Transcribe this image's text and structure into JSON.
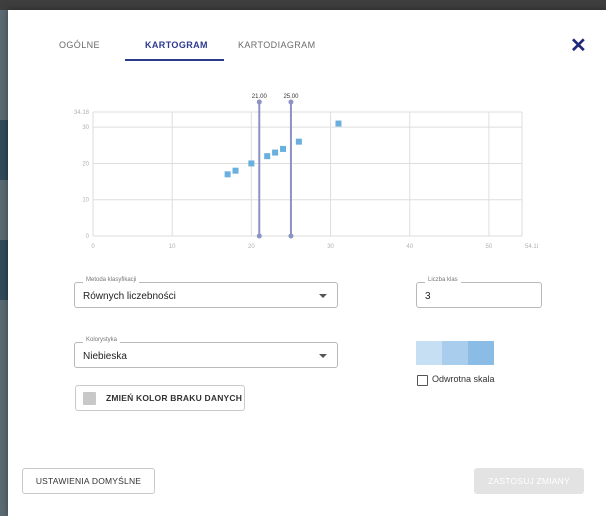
{
  "tabs": [
    {
      "label": "OGÓLNE",
      "active": false
    },
    {
      "label": "KARTOGRAM",
      "active": true
    },
    {
      "label": "KARTODIAGRAM",
      "active": false
    }
  ],
  "close_icon": "close-icon",
  "chart_data": {
    "type": "scatter",
    "xlim": [
      0,
      54.18
    ],
    "ylim": [
      0,
      34.18
    ],
    "x_ticks": [
      0,
      10,
      20,
      30,
      40,
      50
    ],
    "x_max_label": "54.18",
    "y_ticks": [
      0,
      10,
      20,
      30
    ],
    "y_max_label": "34.18",
    "grid": true,
    "points": [
      {
        "x": 17,
        "y": 17
      },
      {
        "x": 18,
        "y": 18
      },
      {
        "x": 20,
        "y": 20
      },
      {
        "x": 22,
        "y": 22
      },
      {
        "x": 23,
        "y": 23
      },
      {
        "x": 24,
        "y": 24
      },
      {
        "x": 26,
        "y": 26
      },
      {
        "x": 31,
        "y": 31
      }
    ],
    "breaks": [
      {
        "x": 21,
        "label": "21.00"
      },
      {
        "x": 25,
        "label": "25.00"
      }
    ],
    "point_color": "#6ab0de",
    "break_color": "#8c93c4"
  },
  "classification": {
    "legend": "Metoda klasyfikacji",
    "value": "Równych liczebności"
  },
  "classes": {
    "legend": "Liczba klas",
    "value": "3"
  },
  "color_scheme": {
    "legend": "Kolorystyka",
    "value": "Niebieska"
  },
  "swatches": [
    "#c6dff2",
    "#a9cdec",
    "#8bbce6"
  ],
  "reverse_scale": {
    "label": "Odwrotna skala",
    "checked": false
  },
  "missing_color_button": {
    "label": "ZMIEŃ KOLOR BRAKU DANYCH",
    "chip_color": "#c8c8c8"
  },
  "default_button": {
    "label": "USTAWIENIA DOMYŚLNE"
  },
  "apply_button": {
    "label": "ZASTOSUJ ZMIANY",
    "disabled": true
  }
}
